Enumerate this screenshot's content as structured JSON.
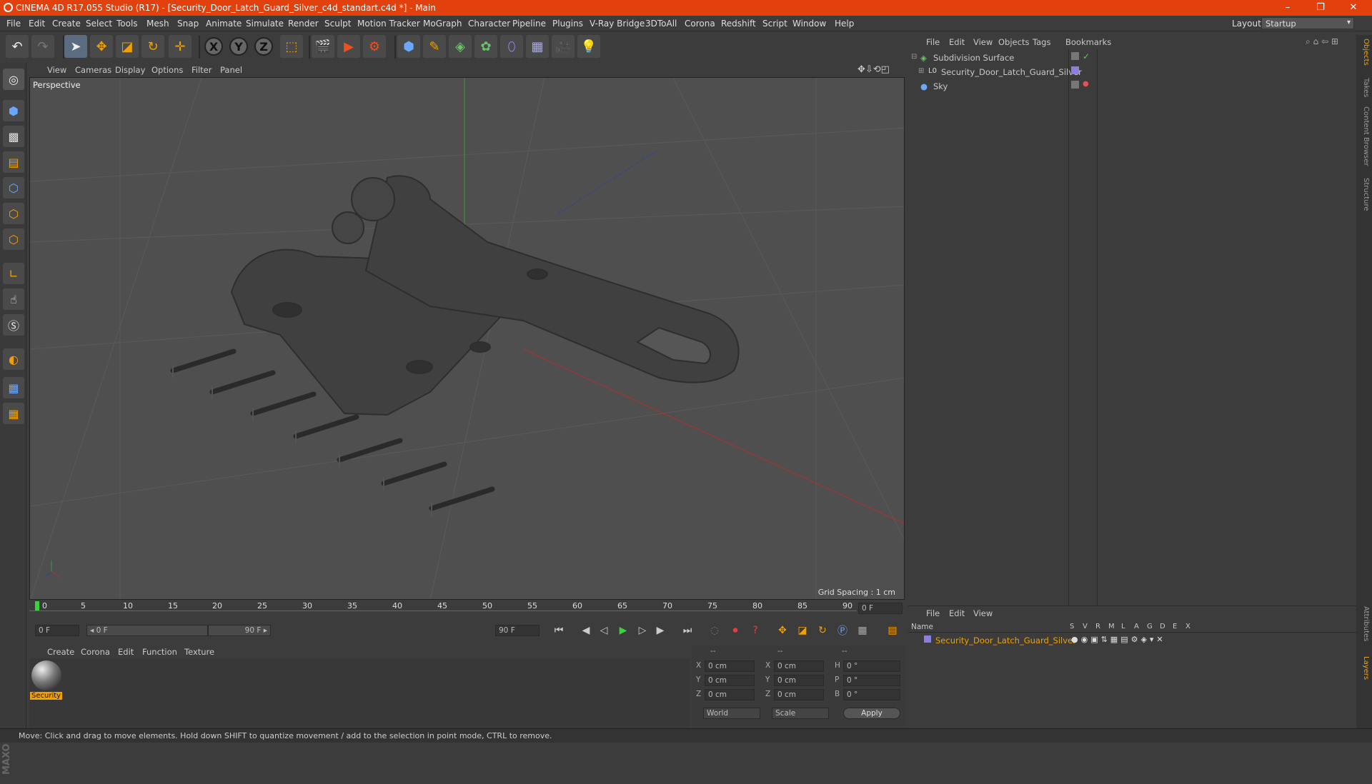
{
  "window": {
    "title": "CINEMA 4D R17.055 Studio (R17) - [Security_Door_Latch_Guard_Silver_c4d_standart.c4d *] - Main",
    "minimize": "–",
    "maximize": "❐",
    "close": "✕"
  },
  "menubar": {
    "items": [
      "File",
      "Edit",
      "Create",
      "Select",
      "Tools",
      "Mesh",
      "Snap",
      "Animate",
      "Simulate",
      "Render",
      "Sculpt",
      "Motion Tracker",
      "MoGraph",
      "Character",
      "Pipeline",
      "Plugins",
      "V-Ray Bridge",
      "3DToAll",
      "Corona",
      "Redshift",
      "Script",
      "Window",
      "Help"
    ],
    "layout_label": "Layout:",
    "layout_value": "Startup"
  },
  "toolbar": {
    "axis_x": "X",
    "axis_y": "Y",
    "axis_z": "Z"
  },
  "viewport": {
    "menu": [
      "View",
      "Cameras",
      "Display",
      "Options",
      "Filter",
      "Panel"
    ],
    "label": "Perspective",
    "grid_spacing": "Grid Spacing : 1 cm"
  },
  "objects": {
    "menu": [
      "File",
      "Edit",
      "View",
      "Objects",
      "Tags",
      "Bookmarks"
    ],
    "rows": [
      {
        "name": "Subdivision Surface"
      },
      {
        "name": "Security_Door_Latch_Guard_Silver"
      },
      {
        "name": "Sky"
      }
    ]
  },
  "right_tabs": [
    "Objects",
    "Takes",
    "Content Browser",
    "Structure",
    "Attributes",
    "Layers"
  ],
  "timeline": {
    "ticks": [
      "0",
      "5",
      "10",
      "15",
      "20",
      "25",
      "30",
      "35",
      "40",
      "45",
      "50",
      "55",
      "60",
      "65",
      "70",
      "75",
      "80",
      "85",
      "90"
    ],
    "current_frame": "0 F"
  },
  "transport": {
    "start_field": "0 F",
    "range_start": "◂ 0 F",
    "range_end": "90 F ▸",
    "end_field": "90 F"
  },
  "materials": {
    "menu": [
      "Create",
      "Corona",
      "Edit",
      "Function",
      "Texture"
    ],
    "items": [
      {
        "name": "Security"
      }
    ]
  },
  "coordinates": {
    "headers": [
      "--",
      "--",
      "--"
    ],
    "rows": [
      {
        "a": "X",
        "av": "0 cm",
        "b": "X",
        "bv": "0 cm",
        "c": "H",
        "cv": "0 °"
      },
      {
        "a": "Y",
        "av": "0 cm",
        "b": "Y",
        "bv": "0 cm",
        "c": "P",
        "cv": "0 °"
      },
      {
        "a": "Z",
        "av": "0 cm",
        "b": "Z",
        "bv": "0 cm",
        "c": "B",
        "cv": "0 °"
      }
    ],
    "mode1": "World",
    "mode2": "Scale",
    "apply": "Apply"
  },
  "layers": {
    "menu": [
      "File",
      "Edit",
      "View"
    ],
    "name_header": "Name",
    "columns": [
      "S",
      "V",
      "R",
      "M",
      "L",
      "A",
      "G",
      "D",
      "E",
      "X"
    ],
    "rows": [
      {
        "name": "Security_Door_Latch_Guard_Silver"
      }
    ]
  },
  "status": "Move: Click and drag to move elements. Hold down SHIFT to quantize movement / add to the selection in point mode, CTRL to remove.",
  "colors": {
    "titlebar": "#e2410d",
    "accent_orange": "#f0a000",
    "layer_color": "#8a7fe0"
  }
}
